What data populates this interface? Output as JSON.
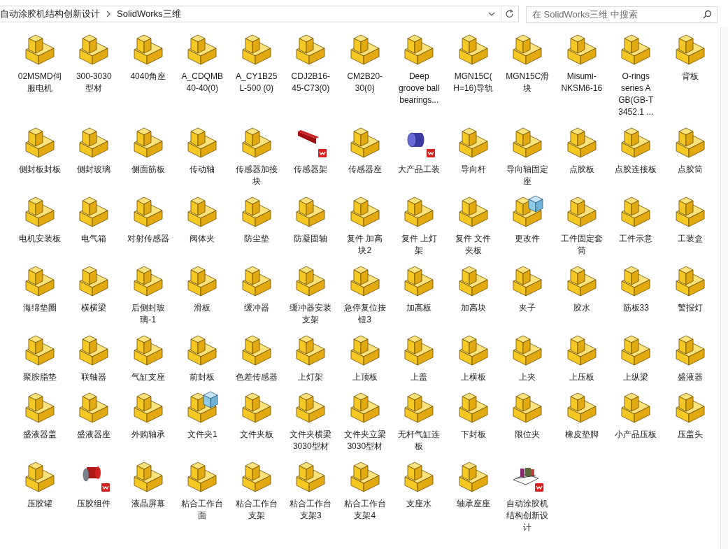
{
  "address_bar": {
    "breadcrumbs": [
      "自动涂胶机结构创新设计",
      "SolidWorks三维"
    ]
  },
  "search": {
    "placeholder": "在 SolidWorks三维 中搜索"
  },
  "files": [
    {
      "name": "02MSMD伺服电机",
      "kind": "part"
    },
    {
      "name": "300-3030型材",
      "kind": "part"
    },
    {
      "name": "4040角座",
      "kind": "part"
    },
    {
      "name": "A_CDQMB40-40(0)",
      "kind": "part"
    },
    {
      "name": "A_CY1B25L-500 (0)",
      "kind": "part"
    },
    {
      "name": "CDJ2B16-45-C73(0)",
      "kind": "part"
    },
    {
      "name": "CM2B20-30(0)",
      "kind": "part"
    },
    {
      "name": "Deep groove ball bearings...",
      "kind": "part"
    },
    {
      "name": "MGN15C(H=16)导轨",
      "kind": "part"
    },
    {
      "name": "MGN15C滑块",
      "kind": "part"
    },
    {
      "name": "Misumi-NKSM6-16",
      "kind": "part"
    },
    {
      "name": "O-rings series A GB(GB-T 3452.1 ...",
      "kind": "part"
    },
    {
      "name": "背板",
      "kind": "part"
    },
    {
      "name": "侧封板封板",
      "kind": "part"
    },
    {
      "name": "侧封玻璃",
      "kind": "part"
    },
    {
      "name": "侧面筋板",
      "kind": "part"
    },
    {
      "name": "传动轴",
      "kind": "part"
    },
    {
      "name": "传感器加接块",
      "kind": "part"
    },
    {
      "name": "传感器架",
      "kind": "bar"
    },
    {
      "name": "传感器座",
      "kind": "part"
    },
    {
      "name": "大产品工装",
      "kind": "cylinder"
    },
    {
      "name": "导向杆",
      "kind": "part"
    },
    {
      "name": "导向轴固定座",
      "kind": "part"
    },
    {
      "name": "点胶板",
      "kind": "part"
    },
    {
      "name": "点胶连接板",
      "kind": "part"
    },
    {
      "name": "点胶筒",
      "kind": "part"
    },
    {
      "name": "电机安装板",
      "kind": "part"
    },
    {
      "name": "电气箱",
      "kind": "part"
    },
    {
      "name": "对射传感器",
      "kind": "part"
    },
    {
      "name": "阀体夹",
      "kind": "part"
    },
    {
      "name": "防尘垫",
      "kind": "part"
    },
    {
      "name": "防凝固轴",
      "kind": "part"
    },
    {
      "name": "复件 加高块2",
      "kind": "part"
    },
    {
      "name": "复件 上灯架",
      "kind": "part"
    },
    {
      "name": "复件 文件夹板",
      "kind": "part"
    },
    {
      "name": "更改件",
      "kind": "cube"
    },
    {
      "name": "工件固定套筒",
      "kind": "part"
    },
    {
      "name": "工件示意",
      "kind": "part"
    },
    {
      "name": "工装盒",
      "kind": "part"
    },
    {
      "name": "海绵垫圈",
      "kind": "part"
    },
    {
      "name": "横横梁",
      "kind": "part"
    },
    {
      "name": "后侧封玻璃-1",
      "kind": "part"
    },
    {
      "name": "滑板",
      "kind": "part"
    },
    {
      "name": "缓冲器",
      "kind": "part"
    },
    {
      "name": "缓冲器安装支架",
      "kind": "part"
    },
    {
      "name": "急停复位按钮3",
      "kind": "part"
    },
    {
      "name": "加高板",
      "kind": "part"
    },
    {
      "name": "加高块",
      "kind": "part"
    },
    {
      "name": "夹子",
      "kind": "part"
    },
    {
      "name": "胶水",
      "kind": "part"
    },
    {
      "name": "筋板33",
      "kind": "part"
    },
    {
      "name": "警报灯",
      "kind": "part"
    },
    {
      "name": "聚胺脂垫",
      "kind": "part"
    },
    {
      "name": "联轴器",
      "kind": "part"
    },
    {
      "name": "气缸支座",
      "kind": "part"
    },
    {
      "name": "前封板",
      "kind": "part"
    },
    {
      "name": "色差传感器",
      "kind": "part"
    },
    {
      "name": "上灯架",
      "kind": "part"
    },
    {
      "name": "上顶板",
      "kind": "part"
    },
    {
      "name": "上盖",
      "kind": "part"
    },
    {
      "name": "上横板",
      "kind": "part"
    },
    {
      "name": "上夹",
      "kind": "part"
    },
    {
      "name": "上压板",
      "kind": "part"
    },
    {
      "name": "上纵梁",
      "kind": "part"
    },
    {
      "name": "盛液器",
      "kind": "part"
    },
    {
      "name": "盛液器盖",
      "kind": "part"
    },
    {
      "name": "盛液器座",
      "kind": "part"
    },
    {
      "name": "外购轴承",
      "kind": "part"
    },
    {
      "name": "文件夹1",
      "kind": "cube"
    },
    {
      "name": "文件夹板",
      "kind": "part"
    },
    {
      "name": "文件夹横梁3030型材",
      "kind": "part"
    },
    {
      "name": "文件夹立梁3030型材",
      "kind": "part"
    },
    {
      "name": "无杆气缸连板",
      "kind": "part"
    },
    {
      "name": "下封板",
      "kind": "part"
    },
    {
      "name": "限位夹",
      "kind": "part"
    },
    {
      "name": "橡皮垫脚",
      "kind": "part"
    },
    {
      "name": "小产品压板",
      "kind": "part"
    },
    {
      "name": "压盖头",
      "kind": "part"
    },
    {
      "name": "压胶罐",
      "kind": "part"
    },
    {
      "name": "压胶组件",
      "kind": "spool"
    },
    {
      "name": "液晶屏幕",
      "kind": "part"
    },
    {
      "name": "粘合工作台面",
      "kind": "part"
    },
    {
      "name": "粘合工作台支架",
      "kind": "part"
    },
    {
      "name": "粘合工作台支架3",
      "kind": "part"
    },
    {
      "name": "粘合工作台支架4",
      "kind": "part"
    },
    {
      "name": "支座水",
      "kind": "part"
    },
    {
      "name": "轴承座座",
      "kind": "part"
    },
    {
      "name": "自动涂胶机结构创新设计",
      "kind": "assembly"
    }
  ]
}
